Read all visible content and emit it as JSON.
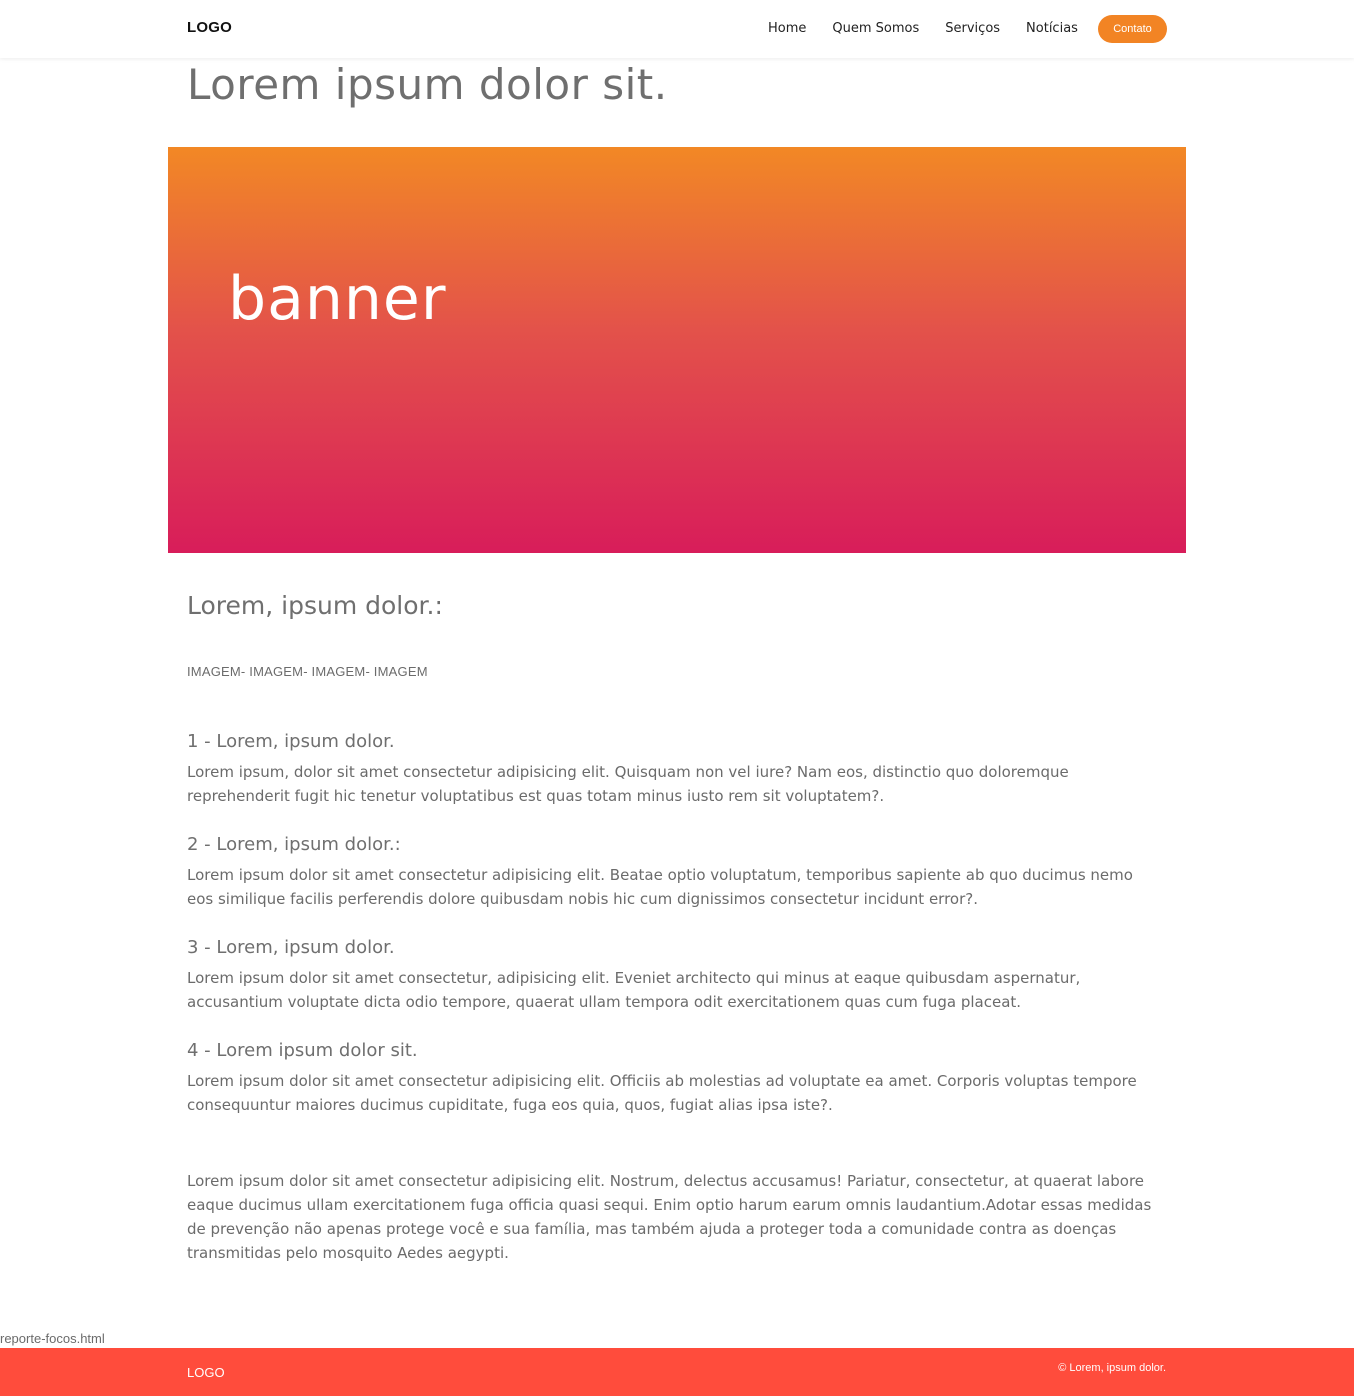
{
  "header": {
    "logo": "LOGO",
    "nav": [
      "Home",
      "Quem Somos",
      "Serviços",
      "Notícias"
    ],
    "contact_button": "Contato"
  },
  "page": {
    "title": "Lorem ipsum dolor sit.",
    "banner_text": "banner",
    "section_title": "Lorem, ipsum dolor.:",
    "imagem_text": "IMAGEM- IMAGEM- IMAGEM- IMAGEM"
  },
  "items": [
    {
      "title": "1 - Lorem, ipsum dolor.",
      "text": "Lorem ipsum, dolor sit amet consectetur adipisicing elit. Quisquam non vel iure? Nam eos, distinctio quo doloremque reprehenderit fugit hic tenetur voluptatibus est quas totam minus iusto rem sit voluptatem?."
    },
    {
      "title": "2 - Lorem, ipsum dolor.:",
      "text": "Lorem ipsum dolor sit amet consectetur adipisicing elit. Beatae optio voluptatum, temporibus sapiente ab quo ducimus nemo eos similique facilis perferendis dolore quibusdam nobis hic cum dignissimos consectetur incidunt error?."
    },
    {
      "title": "3 - Lorem, ipsum dolor.",
      "text": "Lorem ipsum dolor sit amet consectetur, adipisicing elit. Eveniet architecto qui minus at eaque quibusdam aspernatur, accusantium voluptate dicta odio tempore, quaerat ullam tempora odit exercitationem quas cum fuga placeat."
    },
    {
      "title": "4 - Lorem ipsum dolor sit.",
      "text": "Lorem ipsum dolor sit amet consectetur adipisicing elit. Officiis ab molestias ad voluptate ea amet. Corporis voluptas tempore consequuntur maiores ducimus cupiditate, fuga eos quia, quos, fugiat alias ipsa iste?."
    }
  ],
  "closing_text": "Lorem ipsum dolor sit amet consectetur adipisicing elit. Nostrum, delectus accusamus! Pariatur, consectetur, at quaerat labore eaque ducimus ullam exercitationem fuga officia quasi sequi. Enim optio harum earum omnis laudantium.Adotar essas medidas de prevenção não apenas protege você e sua família, mas também ajuda a proteger toda a comunidade contra as doenças transmitidas pelo mosquito Aedes aegypti.",
  "file_label": "reporte-focos.html",
  "footer": {
    "logo": "LOGO",
    "copyright": "© Lorem, ipsum dolor."
  },
  "colors": {
    "accent": "#f28424",
    "footer": "#ff4c3c",
    "banner_top": "#f28825",
    "banner_bottom": "#d81d5a"
  }
}
